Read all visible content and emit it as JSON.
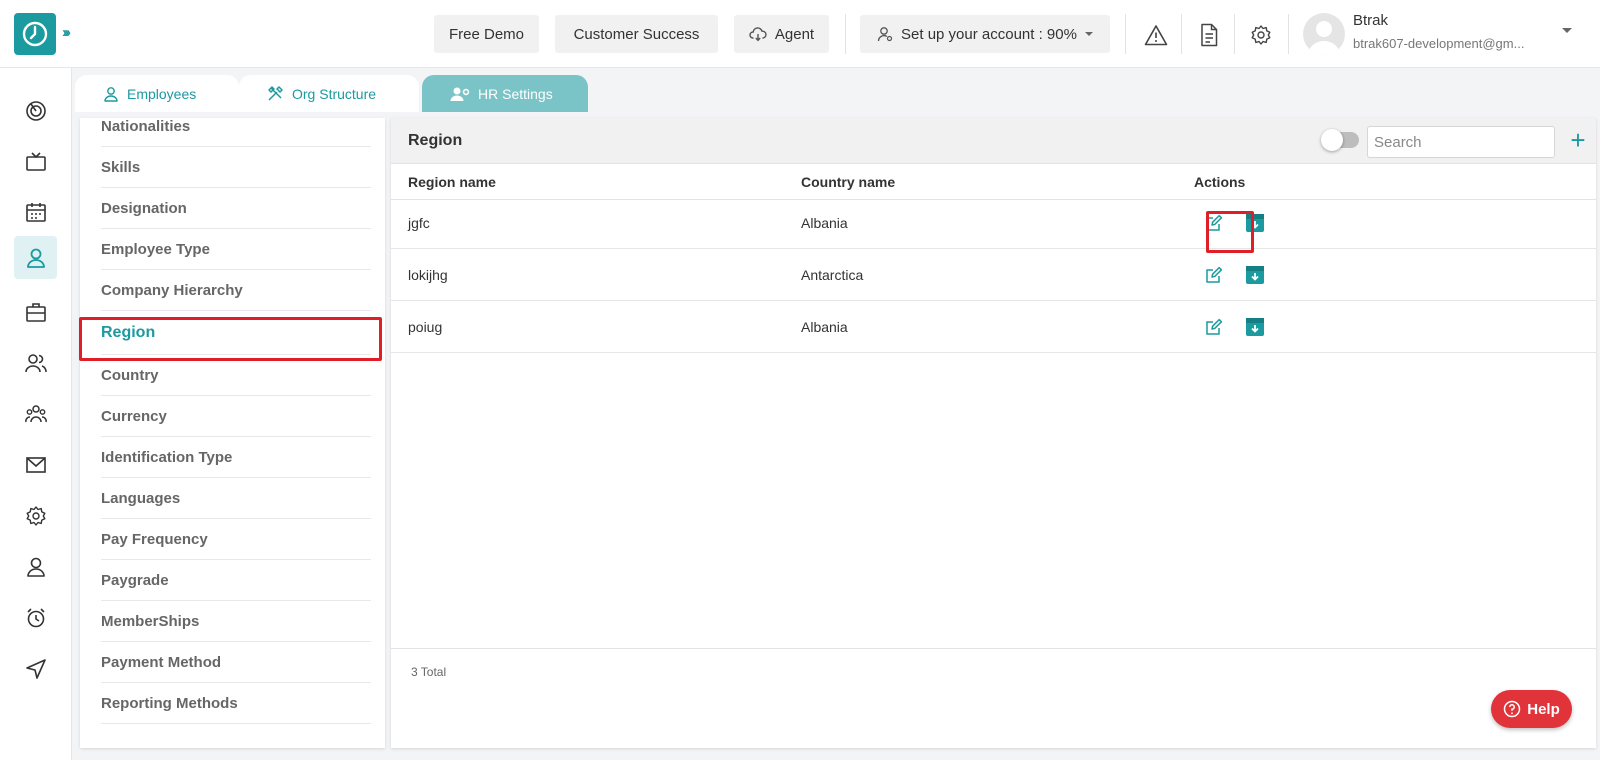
{
  "header": {
    "free_demo": "Free Demo",
    "customer_success": "Customer Success",
    "agent": "Agent",
    "setup": "Set up your account : 90%",
    "user_name": "Btrak",
    "user_email": "btrak607-development@gm..."
  },
  "tabs": [
    {
      "label": "Employees"
    },
    {
      "label": "Org Structure"
    },
    {
      "label": "HR Settings"
    }
  ],
  "settings_menu": {
    "items": [
      {
        "label": "Nationalities"
      },
      {
        "label": "Skills"
      },
      {
        "label": "Designation"
      },
      {
        "label": "Employee Type"
      },
      {
        "label": "Company Hierarchy"
      },
      {
        "label": "Region"
      },
      {
        "label": "Country"
      },
      {
        "label": "Currency"
      },
      {
        "label": "Identification Type"
      },
      {
        "label": "Languages"
      },
      {
        "label": "Pay Frequency"
      },
      {
        "label": "Paygrade"
      },
      {
        "label": "MemberShips"
      },
      {
        "label": "Payment Method"
      },
      {
        "label": "Reporting Methods"
      }
    ]
  },
  "panel": {
    "title": "Region",
    "search_placeholder": "Search",
    "columns": [
      "Region name",
      "Country name",
      "Actions"
    ],
    "rows": [
      {
        "region": "jgfc",
        "country": "Albania"
      },
      {
        "region": "lokijhg",
        "country": "Antarctica"
      },
      {
        "region": "poiug",
        "country": "Albania"
      }
    ],
    "total": "3 Total"
  },
  "help": {
    "label": "Help"
  },
  "colors": {
    "accent": "#1b9aa0",
    "highlight": "#e01e28",
    "help": "#e0343a"
  }
}
